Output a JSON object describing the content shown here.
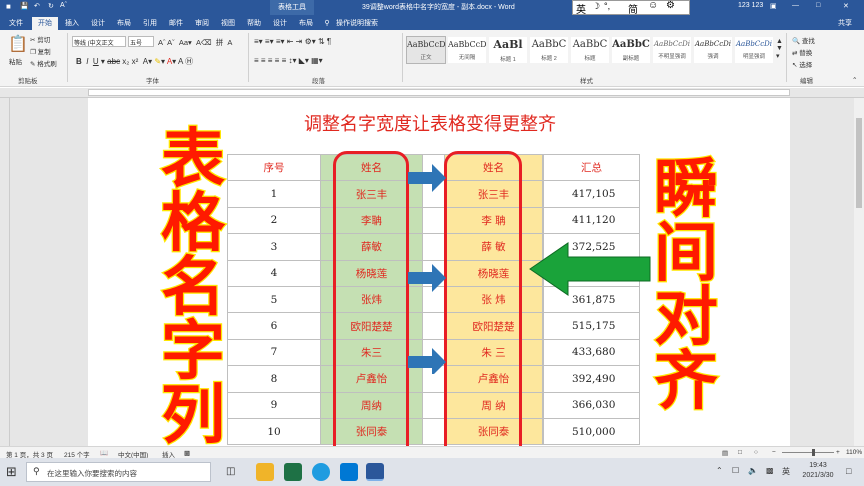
{
  "window": {
    "title": "39调整word表格中名字的宽度 - 副本.docx - Word",
    "table_tools": "表格工具",
    "user": "123 123",
    "ime_lang": "英",
    "ime_mode": "简"
  },
  "tabs": [
    "文件",
    "开始",
    "插入",
    "设计",
    "布局",
    "引用",
    "邮件",
    "审阅",
    "视图",
    "帮助",
    "设计",
    "布局"
  ],
  "tell_me": "操作说明搜索",
  "share": "共享",
  "ribbon": {
    "clipboard": {
      "paste": "粘贴",
      "cut": "剪切",
      "copy": "复制",
      "format_painter": "格式刷",
      "group": "剪贴板"
    },
    "font": {
      "name": "等线 (中文正文",
      "size": "五号",
      "group": "字体"
    },
    "paragraph": {
      "group": "段落"
    },
    "styles": {
      "items": [
        {
          "sample": "AaBbCcDc",
          "label": "正文"
        },
        {
          "sample": "AaBbCcDc",
          "label": "无间隔"
        },
        {
          "sample": "AaBl",
          "label": "标题 1"
        },
        {
          "sample": "AaBbC",
          "label": "标题 2"
        },
        {
          "sample": "AaBbC",
          "label": "标题"
        },
        {
          "sample": "AaBbC",
          "label": "副标题"
        },
        {
          "sample": "AaBbCcDi",
          "label": "不明显强调"
        },
        {
          "sample": "AaBbCcDi",
          "label": "强调"
        },
        {
          "sample": "AaBbCcDi",
          "label": "明显强调"
        }
      ],
      "group": "样式"
    },
    "editing": {
      "find": "查找",
      "replace": "替换",
      "select": "选择",
      "group": "编辑"
    }
  },
  "document": {
    "title": "调整名字宽度让表格变得更整齐",
    "table": {
      "headers": [
        "序号",
        "姓名",
        "",
        "姓名",
        "",
        "汇总"
      ],
      "rows": [
        {
          "no": "1",
          "name1": "张三丰",
          "name2": "张三丰",
          "total": "417,105"
        },
        {
          "no": "2",
          "name1": "李聃",
          "name2": "李 聃",
          "total": "411,120"
        },
        {
          "no": "3",
          "name1": "薛敏",
          "name2": "薛 敏",
          "total": "372,525"
        },
        {
          "no": "4",
          "name1": "杨晓莲",
          "name2": "杨晓莲",
          "total": ""
        },
        {
          "no": "5",
          "name1": "张炜",
          "name2": "张 炜",
          "total": "361,875"
        },
        {
          "no": "6",
          "name1": "欧阳楚楚",
          "name2": "欧阳楚楚",
          "total": "515,175"
        },
        {
          "no": "7",
          "name1": "朱三",
          "name2": "朱 三",
          "total": "433,680"
        },
        {
          "no": "8",
          "name1": "卢鑫怡",
          "name2": "卢鑫怡",
          "total": "392,490"
        },
        {
          "no": "9",
          "name1": "周纳",
          "name2": "周 纳",
          "total": "366,030"
        },
        {
          "no": "10",
          "name1": "张同泰",
          "name2": "张同泰",
          "total": "510,000"
        }
      ]
    },
    "overlay_left": [
      "表",
      "格",
      "名",
      "字",
      "列"
    ],
    "overlay_right": [
      "瞬",
      "间",
      "对",
      "齐"
    ]
  },
  "status": {
    "page": "第 1 页，共 3 页",
    "words": "215 个字",
    "lang": "中文(中国)",
    "mode": "插入",
    "zoom": "110%"
  },
  "taskbar": {
    "search_placeholder": "在这里输入你要搜索的内容",
    "time": "19:43",
    "date": "2021/3/30",
    "ime": "英"
  },
  "colors": {
    "accent": "#2b579a",
    "red": "#e0281f",
    "green": "#c5e0b3",
    "yellow": "#fde79d",
    "arrow_blue": "#2e75b6",
    "arrow_green": "#1aa33a"
  }
}
